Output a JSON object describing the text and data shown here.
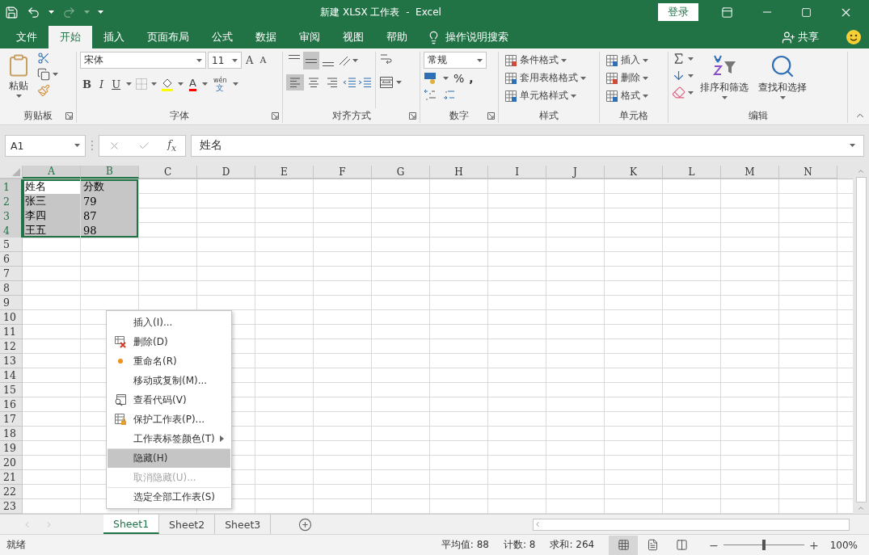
{
  "title_bar": {
    "title": "新建 XLSX 工作表  -  Excel",
    "login": "登录"
  },
  "menu_tabs": [
    {
      "label": "文件",
      "selected": false
    },
    {
      "label": "开始",
      "selected": true
    },
    {
      "label": "插入",
      "selected": false
    },
    {
      "label": "页面布局",
      "selected": false
    },
    {
      "label": "公式",
      "selected": false
    },
    {
      "label": "数据",
      "selected": false
    },
    {
      "label": "审阅",
      "selected": false
    },
    {
      "label": "视图",
      "selected": false
    },
    {
      "label": "帮助",
      "selected": false
    }
  ],
  "tell_me": "操作说明搜索",
  "share": "共享",
  "ribbon": {
    "clipboard": {
      "paste": "粘贴",
      "title": "剪贴板"
    },
    "font": {
      "name": "宋体",
      "size": "11",
      "grow": "A",
      "shrink": "A",
      "styles": [
        {
          "kind": "bold",
          "label": "B"
        },
        {
          "kind": "italic",
          "label": "I"
        },
        {
          "kind": "underline",
          "label": "U"
        }
      ],
      "color_letter": "A",
      "phonetic_top": "wén",
      "phonetic_bottom": "文",
      "title": "字体"
    },
    "alignment": {
      "vertical": [
        {
          "kind": "top",
          "selected": false
        },
        {
          "kind": "middle",
          "selected": true
        },
        {
          "kind": "bottom",
          "selected": false
        }
      ],
      "horizontal": [
        {
          "kind": "left",
          "selected": true
        },
        {
          "kind": "center",
          "selected": false
        },
        {
          "kind": "right",
          "selected": false
        }
      ],
      "title": "对齐方式"
    },
    "number": {
      "format": "常规",
      "symbols": [
        "%",
        ","
      ],
      "title": "数字"
    },
    "styles": {
      "buttons": [
        {
          "kind": "conditional",
          "label": "条件格式"
        },
        {
          "kind": "table",
          "label": "套用表格格式"
        },
        {
          "kind": "cell",
          "label": "单元格样式"
        }
      ],
      "title": "样式"
    },
    "cells": {
      "buttons": [
        {
          "kind": "insert",
          "label": "插入"
        },
        {
          "kind": "delete",
          "label": "删除"
        },
        {
          "kind": "format",
          "label": "格式"
        }
      ],
      "title": "单元格"
    },
    "editing": {
      "sort": "排序和筛选",
      "find": "查找和选择",
      "title": "编辑"
    }
  },
  "formula_bar": {
    "name_box": "A1",
    "fx": "f$_{x}$",
    "content": "姓名"
  },
  "sheet": {
    "columns": [
      {
        "label": "A",
        "selected": true
      },
      {
        "label": "B",
        "selected": true
      },
      {
        "label": "C",
        "selected": false
      },
      {
        "label": "D",
        "selected": false
      },
      {
        "label": "E",
        "selected": false
      },
      {
        "label": "F",
        "selected": false
      },
      {
        "label": "G",
        "selected": false
      },
      {
        "label": "H",
        "selected": false
      },
      {
        "label": "I",
        "selected": false
      },
      {
        "label": "J",
        "selected": false
      },
      {
        "label": "K",
        "selected": false
      },
      {
        "label": "L",
        "selected": false
      },
      {
        "label": "M",
        "selected": false
      },
      {
        "label": "N",
        "selected": false
      }
    ],
    "rows": [
      {
        "header": "1",
        "selected": true,
        "cells": [
          {
            "text": "姓名",
            "selected": true,
            "active": true
          },
          {
            "text": "分数",
            "selected": true,
            "active": false
          }
        ]
      },
      {
        "header": "2",
        "selected": true,
        "cells": [
          {
            "text": "张三",
            "selected": true,
            "active": false
          },
          {
            "text": "79",
            "selected": true,
            "active": false
          }
        ]
      },
      {
        "header": "3",
        "selected": true,
        "cells": [
          {
            "text": "李四",
            "selected": true,
            "active": false
          },
          {
            "text": "87",
            "selected": true,
            "active": false
          }
        ]
      },
      {
        "header": "4",
        "selected": true,
        "cells": [
          {
            "text": "王五",
            "selected": true,
            "active": false
          },
          {
            "text": "98",
            "selected": true,
            "active": false
          }
        ]
      },
      {
        "header": "5",
        "selected": false
      },
      {
        "header": "6",
        "selected": false
      },
      {
        "header": "7",
        "selected": false
      },
      {
        "header": "8",
        "selected": false
      },
      {
        "header": "9",
        "selected": false
      },
      {
        "header": "10",
        "selected": false
      },
      {
        "header": "11",
        "selected": false
      },
      {
        "header": "12",
        "selected": false
      },
      {
        "header": "13",
        "selected": false
      },
      {
        "header": "14",
        "selected": false
      },
      {
        "header": "15",
        "selected": false
      },
      {
        "header": "16",
        "selected": false
      },
      {
        "header": "17",
        "selected": false
      },
      {
        "header": "18",
        "selected": false
      },
      {
        "header": "19",
        "selected": false
      },
      {
        "header": "20",
        "selected": false
      },
      {
        "header": "21",
        "selected": false
      },
      {
        "header": "22",
        "selected": false
      },
      {
        "header": "23",
        "selected": false
      }
    ]
  },
  "context_menu": [
    {
      "label": "插入(I)...",
      "kind": "plain",
      "selected": false,
      "disabled": false,
      "divider_before": false
    },
    {
      "label": "删除(D)",
      "kind": "delete",
      "selected": false,
      "disabled": false,
      "divider_before": false
    },
    {
      "label": "重命名(R)",
      "kind": "dot",
      "selected": false,
      "disabled": false,
      "divider_before": false
    },
    {
      "label": "移动或复制(M)...",
      "kind": "plain",
      "selected": false,
      "disabled": false,
      "divider_before": false
    },
    {
      "label": "查看代码(V)",
      "kind": "code",
      "selected": false,
      "disabled": false,
      "divider_before": false
    },
    {
      "label": "保护工作表(P)...",
      "kind": "protect",
      "selected": false,
      "disabled": false,
      "divider_before": false
    },
    {
      "label": "工作表标签颜色(T)",
      "kind": "submenu",
      "selected": false,
      "disabled": false,
      "divider_before": false
    },
    {
      "label": "隐藏(H)",
      "kind": "plain",
      "selected": true,
      "disabled": false,
      "divider_before": true
    },
    {
      "label": "取消隐藏(U)...",
      "kind": "plain",
      "selected": false,
      "disabled": true,
      "divider_before": false
    },
    {
      "label": "选定全部工作表(S)",
      "kind": "plain",
      "selected": false,
      "disabled": false,
      "divider_before": true
    }
  ],
  "sheet_tabs": [
    {
      "label": "Sheet1",
      "selected": true
    },
    {
      "label": "Sheet2",
      "selected": false
    },
    {
      "label": "Sheet3",
      "selected": false
    }
  ],
  "status_bar": {
    "ready": "就绪",
    "stats": [
      "平均值: 88",
      "计数: 8",
      "求和: 264"
    ],
    "views": [
      {
        "kind": "normal",
        "selected": true
      },
      {
        "kind": "page-layout",
        "selected": false
      },
      {
        "kind": "page-break",
        "selected": false
      }
    ],
    "zoom_out": "−",
    "zoom_in": "+",
    "zoom": {
      "level": 0.5
    },
    "zoom_label": "100%"
  }
}
